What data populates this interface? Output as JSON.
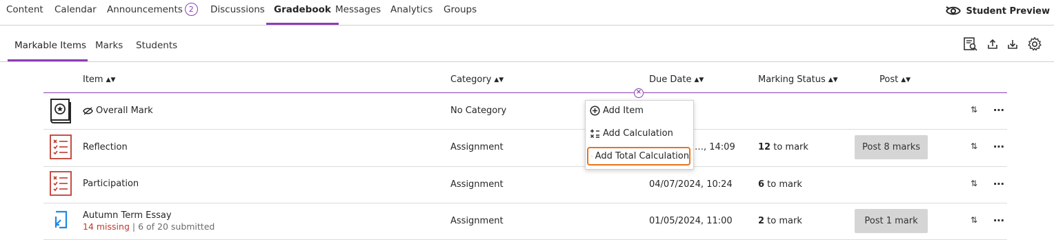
{
  "top_nav": {
    "tabs": [
      "Content",
      "Calendar",
      "Announcements",
      "Discussions",
      "Gradebook",
      "Messages",
      "Analytics",
      "Groups"
    ],
    "announcements_badge": "2",
    "active": "Gradebook",
    "student_preview": "Student Preview"
  },
  "sub_nav": {
    "tabs": [
      "Markable Items",
      "Marks",
      "Students"
    ],
    "active": "Markable Items"
  },
  "table": {
    "headers": [
      "Item",
      "Category",
      "Due Date",
      "Marking Status",
      "Post"
    ],
    "rows": [
      {
        "name": "Overall Mark",
        "category": "No Category",
        "due": "",
        "status_count": "",
        "status_text": "",
        "post": "",
        "icon": "overall-mark-icon",
        "hidden": true
      },
      {
        "name": "Reflection",
        "category": "Assignment",
        "due": "…, 14:09",
        "status_count": "12",
        "status_text": " to mark",
        "post": "Post 8 marks",
        "icon": "assignment-icon"
      },
      {
        "name": "Participation",
        "category": "Assignment",
        "due": "04/07/2024, 10:24",
        "status_count": "6",
        "status_text": " to mark",
        "post": "",
        "icon": "assignment-icon"
      },
      {
        "name": "Autumn Term Essay",
        "category": "Assignment",
        "due": "01/05/2024, 11:00",
        "status_count": "2",
        "status_text": " to mark",
        "post": "Post 1 mark",
        "icon": "essay-icon",
        "missing": "14 missing",
        "separator": " | ",
        "submitted": "6 of 20 submitted"
      }
    ]
  },
  "menu": {
    "items": [
      "Add Item",
      "Add Calculation",
      "Add Total Calculation"
    ],
    "highlighted": "Add Total Calculation"
  },
  "colors": {
    "accent": "#8a3fb5",
    "assignment_icon": "#c0392b",
    "essay_icon": "#1e88e5",
    "highlight": "#e8731a",
    "post_button": "#d5d5d5"
  }
}
